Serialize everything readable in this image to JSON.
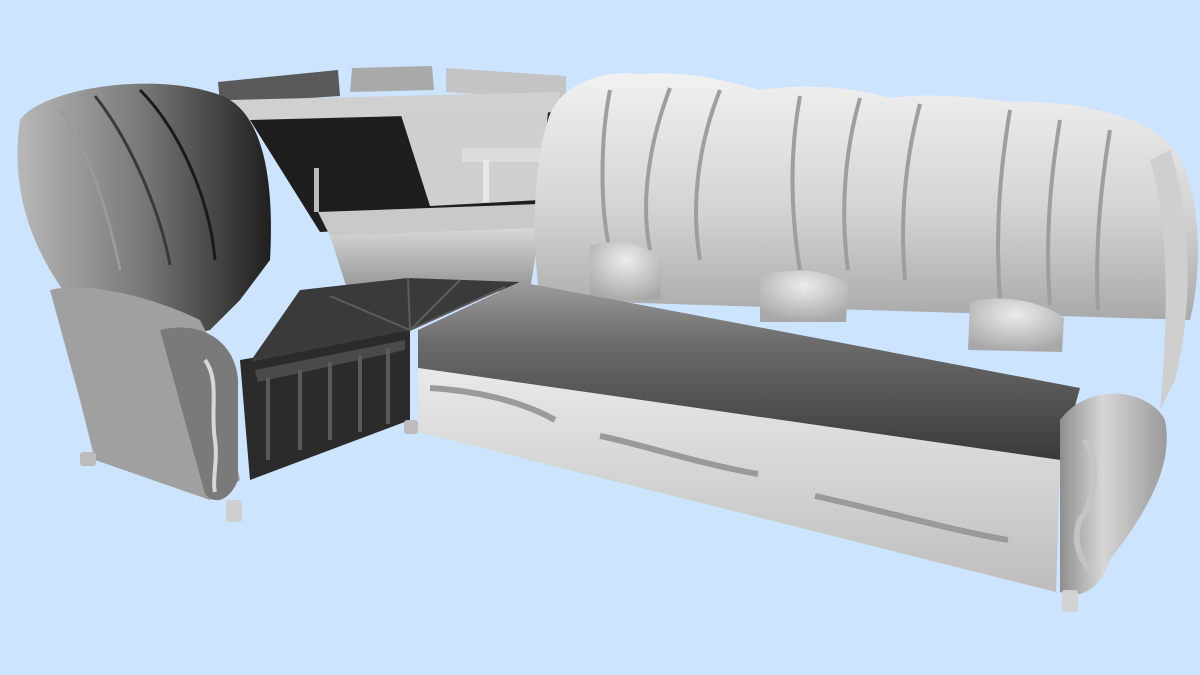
{
  "scene": {
    "subject": "corner-sofa-3d-render",
    "background_color": "#cde4ff",
    "colors": {
      "upholstery_light": "#d9d9d9",
      "upholstery_mid": "#9a9a9a",
      "upholstery_dark": "#2a2a2a",
      "wood_shelf": "#bdbdbd",
      "metal": "#cfcfcf"
    }
  }
}
